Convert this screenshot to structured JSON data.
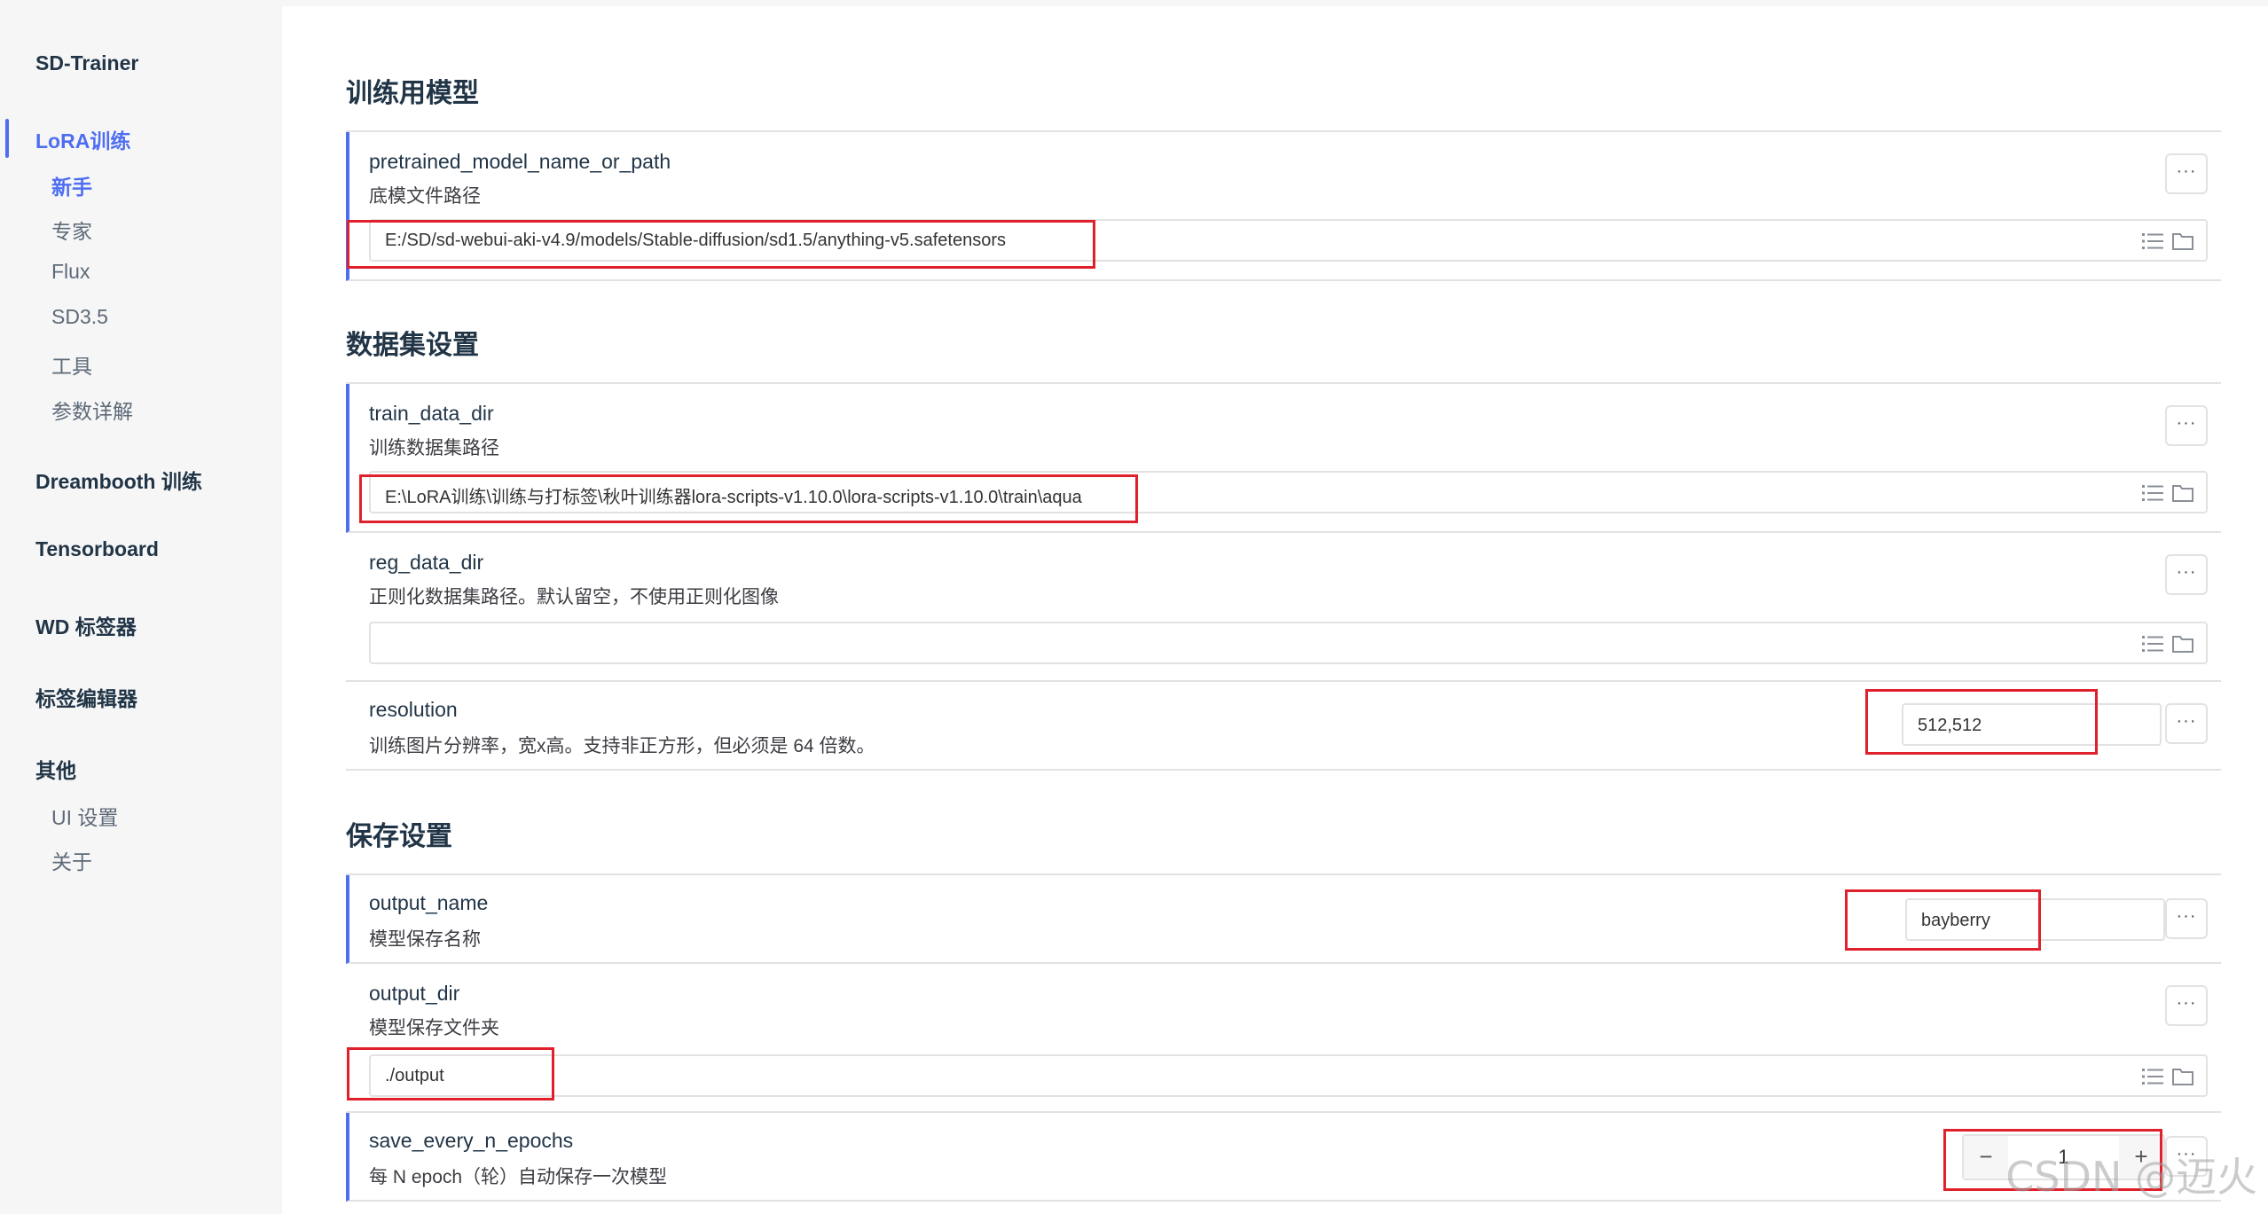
{
  "sidebar": {
    "brand": "SD-Trainer",
    "lora": {
      "label": "LoRA训练",
      "items": [
        "新手",
        "专家",
        "Flux",
        "SD3.5",
        "工具",
        "参数详解"
      ]
    },
    "groups": [
      "Dreambooth 训练",
      "Tensorboard",
      "WD 标签器",
      "标签编辑器"
    ],
    "other": {
      "label": "其他",
      "items": [
        "UI 设置",
        "关于"
      ]
    }
  },
  "sections": {
    "model": "训练用模型",
    "dataset": "数据集设置",
    "save": "保存设置"
  },
  "fields": {
    "pretrained": {
      "name": "pretrained_model_name_or_path",
      "desc": "底模文件路径",
      "value": "E:/SD/sd-webui-aki-v4.9/models/Stable-diffusion/sd1.5/anything-v5.safetensors"
    },
    "train_data_dir": {
      "name": "train_data_dir",
      "desc": "训练数据集路径",
      "value": "E:\\LoRA训练\\训练与打标签\\秋叶训练器lora-scripts-v1.10.0\\lora-scripts-v1.10.0\\train\\aqua"
    },
    "reg_data_dir": {
      "name": "reg_data_dir",
      "desc": "正则化数据集路径。默认留空，不使用正则化图像",
      "value": ""
    },
    "resolution": {
      "name": "resolution",
      "desc": "训练图片分辨率，宽x高。支持非正方形，但必须是 64 倍数。",
      "value": "512,512"
    },
    "output_name": {
      "name": "output_name",
      "desc": "模型保存名称",
      "value": "bayberry"
    },
    "output_dir": {
      "name": "output_dir",
      "desc": "模型保存文件夹",
      "value": "./output"
    },
    "save_every_n_epochs": {
      "name": "save_every_n_epochs",
      "desc": "每 N epoch（轮）自动保存一次模型",
      "value": "1"
    }
  },
  "controls": {
    "menu": "···",
    "minus": "−",
    "plus": "+"
  },
  "icons": [
    "list-icon",
    "folder-icon"
  ],
  "colors": {
    "accent": "#4e6ef2",
    "highlight": "#e0202a"
  },
  "watermark": "CSDN @迈火"
}
